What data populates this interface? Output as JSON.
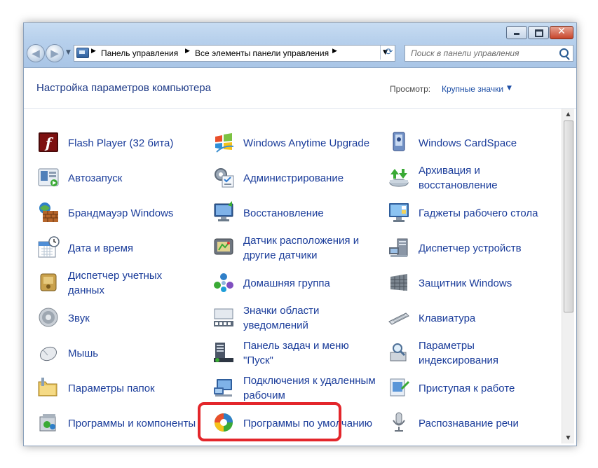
{
  "window": {
    "close_glyph": "✕",
    "nav_back_glyph": "◀",
    "nav_forward_glyph": "▶",
    "dropdown_glyph": "▼",
    "refresh_glyph": "⟳"
  },
  "address": {
    "separator": "▶",
    "crumbs": [
      "Панель управления",
      "Все элементы панели управления"
    ]
  },
  "search": {
    "placeholder": "Поиск в панели управления"
  },
  "header": {
    "title": "Настройка параметров компьютера",
    "view_label": "Просмотр:",
    "view_value": "Крупные значки",
    "view_caret": "▼"
  },
  "scrollbar": {
    "up_glyph": "▲",
    "down_glyph": "▼"
  },
  "items": [
    {
      "label": "Flash Player (32 бита)",
      "icon": "flash-player-icon"
    },
    {
      "label": "Windows Anytime Upgrade",
      "icon": "windows-anytime-upgrade-icon"
    },
    {
      "label": "Windows CardSpace",
      "icon": "cardspace-icon"
    },
    {
      "label": "Автозапуск",
      "icon": "autoplay-icon"
    },
    {
      "label": "Администрирование",
      "icon": "administrative-tools-icon"
    },
    {
      "label": "Архивация и восстановление",
      "icon": "backup-restore-icon"
    },
    {
      "label": "Брандмауэр Windows",
      "icon": "firewall-icon"
    },
    {
      "label": "Восстановление",
      "icon": "recovery-icon"
    },
    {
      "label": "Гаджеты рабочего стола",
      "icon": "desktop-gadgets-icon"
    },
    {
      "label": "Дата и время",
      "icon": "date-time-icon"
    },
    {
      "label": "Датчик расположения и другие датчики",
      "icon": "location-sensors-icon"
    },
    {
      "label": "Диспетчер устройств",
      "icon": "device-manager-icon"
    },
    {
      "label": "Диспетчер учетных данных",
      "icon": "credential-manager-icon"
    },
    {
      "label": "Домашняя группа",
      "icon": "homegroup-icon"
    },
    {
      "label": "Защитник Windows",
      "icon": "windows-defender-icon"
    },
    {
      "label": "Звук",
      "icon": "sound-icon"
    },
    {
      "label": "Значки области уведомлений",
      "icon": "notification-icons-icon"
    },
    {
      "label": "Клавиатура",
      "icon": "keyboard-icon"
    },
    {
      "label": "Мышь",
      "icon": "mouse-icon"
    },
    {
      "label": "Панель задач и меню \"Пуск\"",
      "icon": "taskbar-start-menu-icon"
    },
    {
      "label": "Параметры индексирования",
      "icon": "indexing-options-icon"
    },
    {
      "label": "Параметры папок",
      "icon": "folder-options-icon"
    },
    {
      "label": "Подключения к удаленным рабочим",
      "icon": "remote-desktop-connections-icon"
    },
    {
      "label": "Приступая к работе",
      "icon": "getting-started-icon"
    },
    {
      "label": "Программы и компоненты",
      "icon": "programs-features-icon"
    },
    {
      "label": "Программы по умолчанию",
      "icon": "default-programs-icon"
    },
    {
      "label": "Распознавание речи",
      "icon": "speech-recognition-icon"
    }
  ],
  "colors": {
    "link": "#1a3c9a",
    "title": "#1e3a87",
    "highlight": "#e3262b",
    "frame": "#b7d0ec"
  }
}
